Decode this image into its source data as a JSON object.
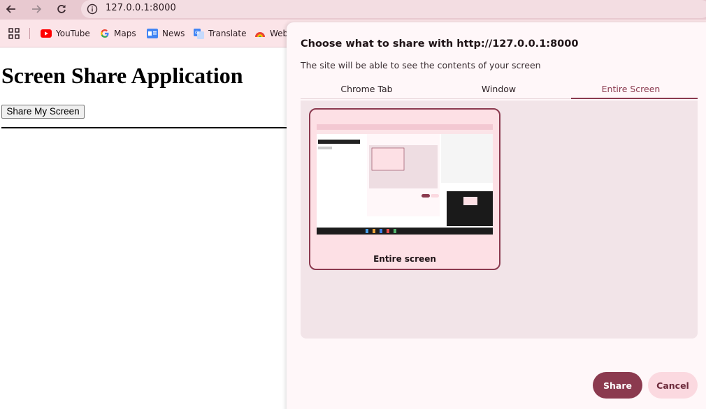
{
  "browser": {
    "url": "127.0.0.1:8000",
    "bookmarks": [
      {
        "label": "YouTube",
        "icon": "youtube-icon"
      },
      {
        "label": "Maps",
        "icon": "google-icon"
      },
      {
        "label": "News",
        "icon": "news-icon"
      },
      {
        "label": "Translate",
        "icon": "translate-icon"
      },
      {
        "label": "Web",
        "icon": "web-icon"
      }
    ]
  },
  "page": {
    "title": "Screen Share Application",
    "button_label": "Share My Screen"
  },
  "dialog": {
    "title": "Choose what to share with http://127.0.0.1:8000",
    "subtitle": "The site will be able to see the contents of your screen",
    "tabs": [
      {
        "label": "Chrome Tab"
      },
      {
        "label": "Window"
      },
      {
        "label": "Entire Screen"
      }
    ],
    "active_tab": "Entire Screen",
    "tile_label": "Entire screen",
    "share_label": "Share",
    "cancel_label": "Cancel"
  },
  "colors": {
    "accent": "#8b3a4f",
    "toolbar": "#e8c9d0",
    "panel": "#f2e4e8"
  }
}
